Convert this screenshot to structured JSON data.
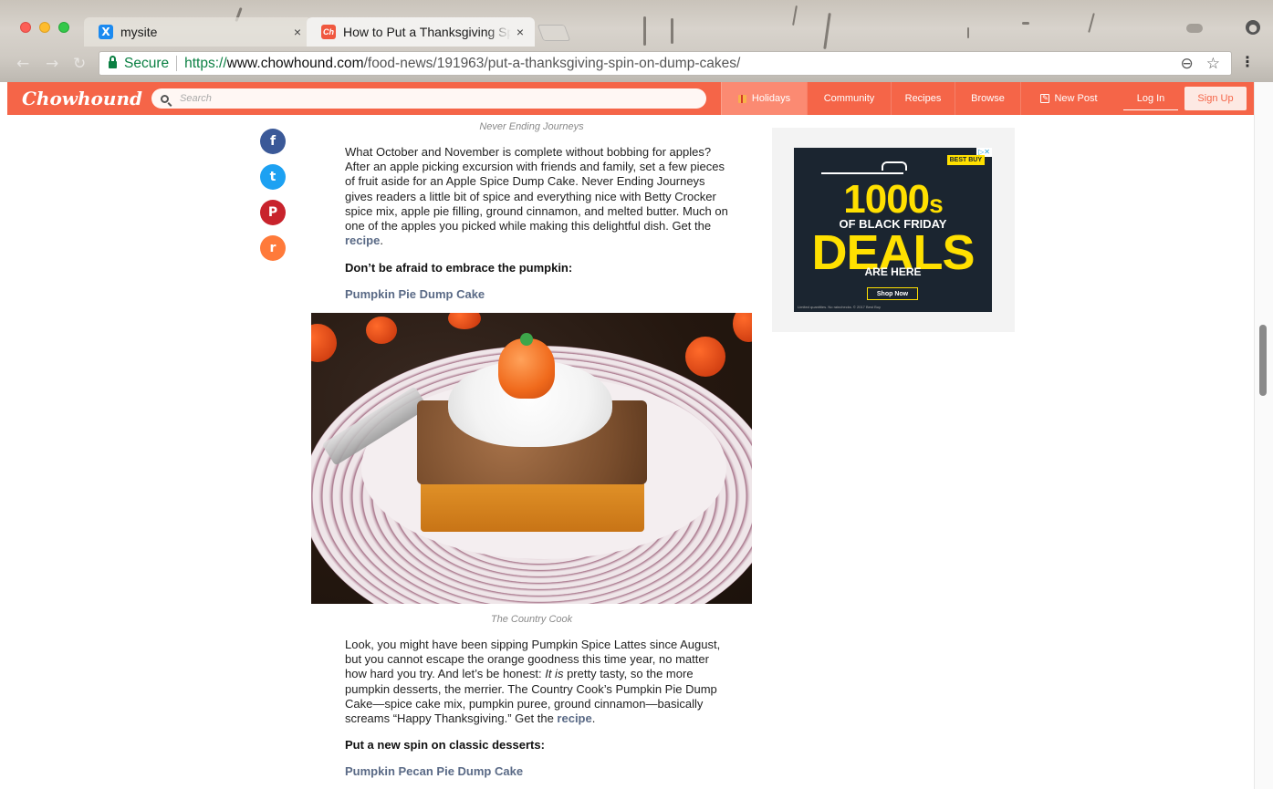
{
  "browser": {
    "tabs": [
      {
        "title": "mysite",
        "favicon": "mysite-favicon",
        "active": false,
        "close": "×"
      },
      {
        "title": "How to Put a Thanksgiving Spin on Dump Cakes",
        "favicon": "chowhound-favicon",
        "active": true,
        "close": "×"
      }
    ],
    "favicon_glyphs": {
      "mysite": "X",
      "chowhound": "Ch"
    },
    "secure_label": "Secure",
    "url": {
      "scheme": "https://",
      "host": "www.chowhound.com",
      "path": "/food-news/191963/put-a-thanksgiving-spin-on-dump-cakes/"
    },
    "icons": [
      "back-icon",
      "forward-icon",
      "reload-icon",
      "zoom-icon",
      "star-icon",
      "menu-icon",
      "profile-icon"
    ],
    "glyphs": {
      "back": "←",
      "forward": "→",
      "reload": "↻",
      "zoom": "⊖",
      "star": "☆",
      "menu": "⋮",
      "profile": "●"
    }
  },
  "site": {
    "logo": "Chowhound",
    "search_placeholder": "Search",
    "nav": {
      "holidays": "Holidays",
      "community": "Community",
      "recipes": "Recipes",
      "browse": "Browse",
      "new_post": "New Post"
    },
    "login": "Log In",
    "signup": "Sign Up",
    "brand_color": "#f56548"
  },
  "social": {
    "facebook": "f",
    "twitter": "t",
    "pinterest": "P",
    "reddit": "r"
  },
  "article": {
    "caption_top": "Never Ending Journeys",
    "para1_text": "What October and November is complete without bobbing for apples? After an apple picking excursion with friends and family, set a few pieces of fruit aside for an Apple Spice Dump Cake. Never Ending Journeys gives readers a little bit of spice and everything nice with Betty Crocker spice mix, apple pie filling, ground cinnamon, and melted butter. Much on one of the apples you picked while making this delightful dish. Get the ",
    "para1_link": "recipe",
    "para1_end": ".",
    "subhead1": "Don’t be afraid to embrace the pumpkin:",
    "link1": "Pumpkin Pie Dump Cake",
    "photo_caption": "The Country Cook",
    "para2_a": "Look, you might have been sipping Pumpkin Spice Lattes since August, but you cannot escape the orange goodness this time year, no matter how hard you try. And let’s be honest: ",
    "para2_italic": "It is",
    "para2_b": " pretty tasty, so the more pumpkin desserts, the merrier. The Country Cook’s Pumpkin Pie Dump Cake—spice cake mix, pumpkin puree, ground cinnamon—basically screams “Happy Thanksgiving.” Get the ",
    "para2_link": "recipe",
    "para2_end": ".",
    "subhead2": "Put a new spin on classic desserts:",
    "link2": "Pumpkin Pecan Pie Dump Cake"
  },
  "ad": {
    "line1": "1000",
    "line1_suffix": "s",
    "line2": "OF BLACK FRIDAY",
    "line3": "DEALS",
    "line4": "ARE HERE",
    "button": "Shop Now",
    "brand": "BEST BUY",
    "adchoices": "▷✕",
    "fine_print": "Limited quantities. No rainchecks. © 2017 Best Buy"
  }
}
